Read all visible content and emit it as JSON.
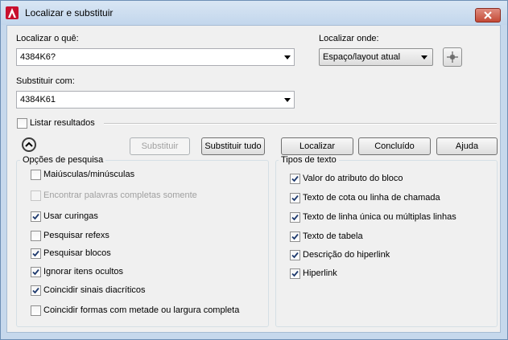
{
  "window": {
    "title": "Localizar e substituir",
    "app_icon": "autocad-a-icon",
    "close_icon": "close-x-icon"
  },
  "find": {
    "label": "Localizar o quê:",
    "value": "4384K6?"
  },
  "replace": {
    "label": "Substituir com:",
    "value": "4384K61"
  },
  "find_where": {
    "label": "Localizar onde:",
    "value": "Espaço/layout atual",
    "pick_icon": "crosshair-icon"
  },
  "list_results": {
    "label": "Listar resultados",
    "checked": false
  },
  "buttons": {
    "replace": "Substituir",
    "replace_all": "Substituir tudo",
    "find": "Localizar",
    "done": "Concluído",
    "help": "Ajuda"
  },
  "search_options": {
    "title": "Opções de pesquisa",
    "items": [
      {
        "label": "Maiúsculas/minúsculas",
        "checked": false,
        "enabled": true
      },
      {
        "label": "Encontrar palavras completas somente",
        "checked": false,
        "enabled": false
      },
      {
        "label": "Usar curingas",
        "checked": true,
        "enabled": true
      },
      {
        "label": "Pesquisar refexs",
        "checked": false,
        "enabled": true
      },
      {
        "label": "Pesquisar blocos",
        "checked": true,
        "enabled": true
      },
      {
        "label": "Ignorar itens ocultos",
        "checked": true,
        "enabled": true
      },
      {
        "label": "Coincidir sinais diacríticos",
        "checked": true,
        "enabled": true
      },
      {
        "label": "Coincidir formas com metade ou largura completa",
        "checked": false,
        "enabled": true
      }
    ]
  },
  "text_types": {
    "title": "Tipos de texto",
    "items": [
      {
        "label": "Valor do atributo do bloco",
        "checked": true
      },
      {
        "label": "Texto de cota ou linha de chamada",
        "checked": true
      },
      {
        "label": "Texto de linha única ou múltiplas linhas",
        "checked": true
      },
      {
        "label": "Texto de tabela",
        "checked": true
      },
      {
        "label": "Descrição do hiperlink",
        "checked": true
      },
      {
        "label": "Hiperlink",
        "checked": true
      }
    ]
  }
}
